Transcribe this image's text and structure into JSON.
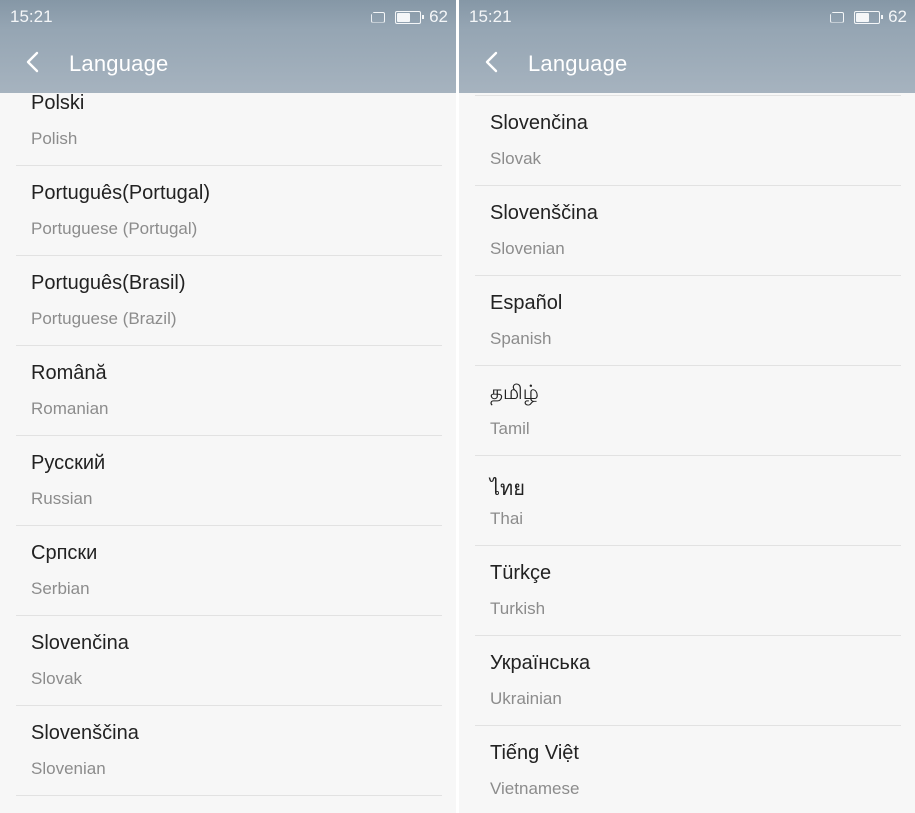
{
  "screens": [
    {
      "status": {
        "time": "15:21",
        "battery": "62",
        "battery_fraction": 0.62
      },
      "title": "Language",
      "items": [
        {
          "native": "Polski",
          "english": "Polish"
        },
        {
          "native": "Português(Portugal)",
          "english": "Portuguese (Portugal)"
        },
        {
          "native": "Português(Brasil)",
          "english": "Portuguese (Brazil)"
        },
        {
          "native": "Română",
          "english": "Romanian"
        },
        {
          "native": "Русский",
          "english": "Russian"
        },
        {
          "native": "Српски",
          "english": "Serbian"
        },
        {
          "native": "Slovenčina",
          "english": "Slovak"
        },
        {
          "native": "Slovenščina",
          "english": "Slovenian"
        }
      ]
    },
    {
      "status": {
        "time": "15:21",
        "battery": "62",
        "battery_fraction": 0.62
      },
      "title": "Language",
      "items": [
        {
          "native": "Slovenčina",
          "english": "Slovak"
        },
        {
          "native": "Slovenščina",
          "english": "Slovenian"
        },
        {
          "native": "Español",
          "english": "Spanish"
        },
        {
          "native": "தமிழ்",
          "english": "Tamil"
        },
        {
          "native": "ไทย",
          "english": "Thai"
        },
        {
          "native": "Türkçe",
          "english": "Turkish"
        },
        {
          "native": "Українська",
          "english": "Ukrainian"
        },
        {
          "native": "Tiếng Việt",
          "english": "Vietnamese"
        }
      ]
    }
  ],
  "icons": {
    "back": "chevron-left-icon",
    "sim": "sim-card-icon",
    "battery": "battery-icon"
  }
}
